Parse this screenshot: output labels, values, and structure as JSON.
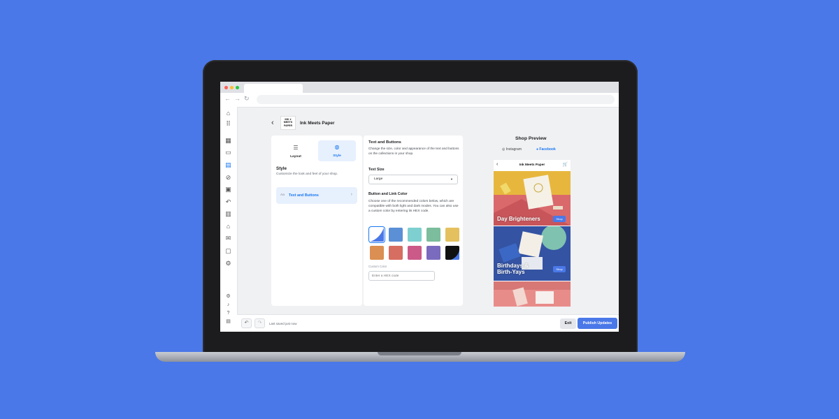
{
  "colors": {
    "background": "#4a78e8",
    "accent": "#1877f2",
    "publish_button": "#4a78e8"
  },
  "shop": {
    "logo_text": [
      "INK ♥",
      "MEETS",
      "PAPER"
    ],
    "name": "Ink Meets Paper"
  },
  "sidebar": {
    "icons": [
      "home-icon",
      "apps-grid-icon",
      "grid-icon",
      "monitor-icon",
      "storefront-icon",
      "block-icon",
      "archive-icon",
      "undo-icon",
      "building-icon",
      "bank-icon",
      "mail-icon",
      "chat-icon",
      "settings-icon",
      "settings-small-icon",
      "bell-icon",
      "help-icon",
      "report-icon"
    ]
  },
  "left_panel": {
    "tabs": [
      {
        "label": "Layout",
        "icon": "list-icon",
        "selected": false
      },
      {
        "label": "Style",
        "icon": "palette-icon",
        "selected": true
      }
    ],
    "title": "Style",
    "description": "Customize the look and feel of your shop.",
    "section_item": {
      "prefix": "Aa",
      "label": "Text and Buttons"
    }
  },
  "middle_panel": {
    "title": "Text and Buttons",
    "description": "Change the size, color and appearance of the text and buttons on the collections in your shop.",
    "text_size_label": "Text Size",
    "text_size_value": "Large",
    "button_color_label": "Button and Link Color",
    "button_color_description": "Choose one of the recommended colors below, which are compatible with both light and dark modes. You can also use a custom color by entering its HEX code.",
    "swatches": [
      "#4a78e8",
      "#5b8fd6",
      "#7ecfcf",
      "#7bbd9c",
      "#e4c15e",
      "#db8f52",
      "#d66e62",
      "#cc5a88",
      "#7b6bbf",
      "#111111"
    ],
    "selected_swatch": 0,
    "custom_color_label": "Custom Color",
    "custom_color_placeholder": "Enter a HEX code"
  },
  "preview": {
    "title": "Shop Preview",
    "tabs": [
      {
        "label": "Instagram",
        "icon": "instagram-icon",
        "selected": false
      },
      {
        "label": "Facebook",
        "icon": "facebook-icon",
        "selected": true
      }
    ],
    "phone_shop_name": "Ink Meets Paper",
    "collections": [
      {
        "label_lines": [
          "Day Brighteners"
        ],
        "button": "Shop"
      },
      {
        "label_lines": [
          "Birthdays &",
          "Birth-Yays"
        ],
        "button": "Shop"
      }
    ]
  },
  "footer": {
    "saved_text": "Last saved just now",
    "exit_label": "Exit",
    "publish_label": "Publish Updates"
  }
}
